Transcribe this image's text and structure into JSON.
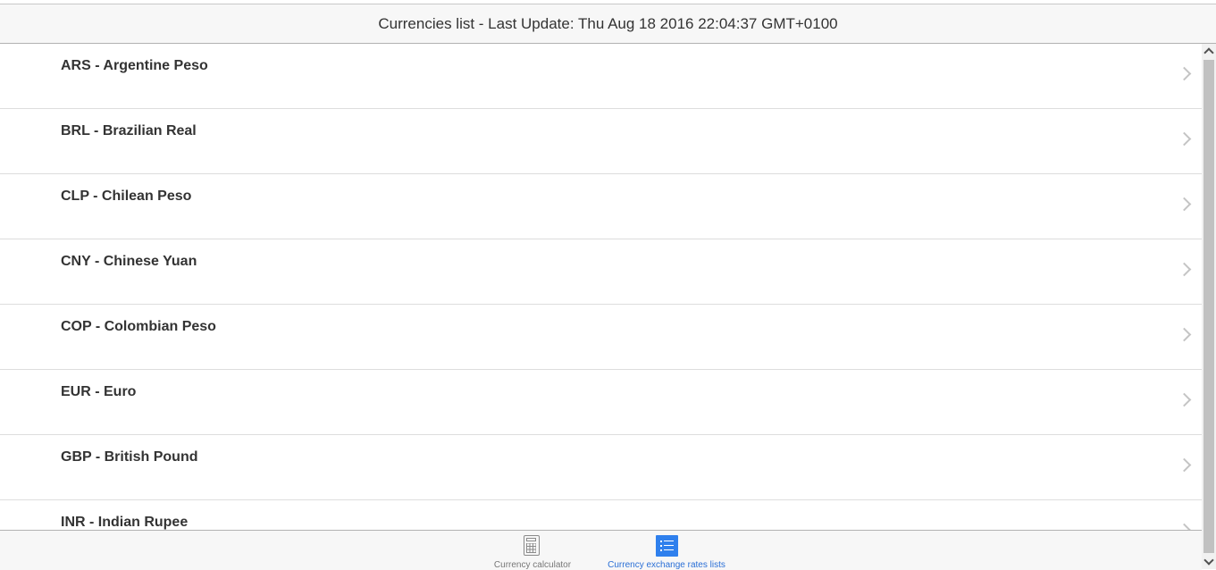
{
  "header": {
    "title": "Currencies list - Last Update: Thu Aug 18 2016 22:04:37 GMT+0100"
  },
  "currencies": [
    {
      "label": "ARS - Argentine Peso"
    },
    {
      "label": "BRL - Brazilian Real"
    },
    {
      "label": "CLP - Chilean Peso"
    },
    {
      "label": "CNY - Chinese Yuan"
    },
    {
      "label": "COP - Colombian Peso"
    },
    {
      "label": "EUR - Euro"
    },
    {
      "label": "GBP - British Pound"
    },
    {
      "label": "INR - Indian Rupee"
    }
  ],
  "tabbar": {
    "tabs": [
      {
        "label": "Currency calculator",
        "icon": "calculator-icon",
        "active": false
      },
      {
        "label": "Currency exchange rates lists",
        "icon": "list-icon",
        "active": true
      }
    ]
  },
  "colors": {
    "accent": "#2f80ed",
    "active_tab_text": "#2a6fd6",
    "inactive_tab_text": "#777777",
    "header_bg": "#f7f7f7",
    "text": "#333333"
  }
}
